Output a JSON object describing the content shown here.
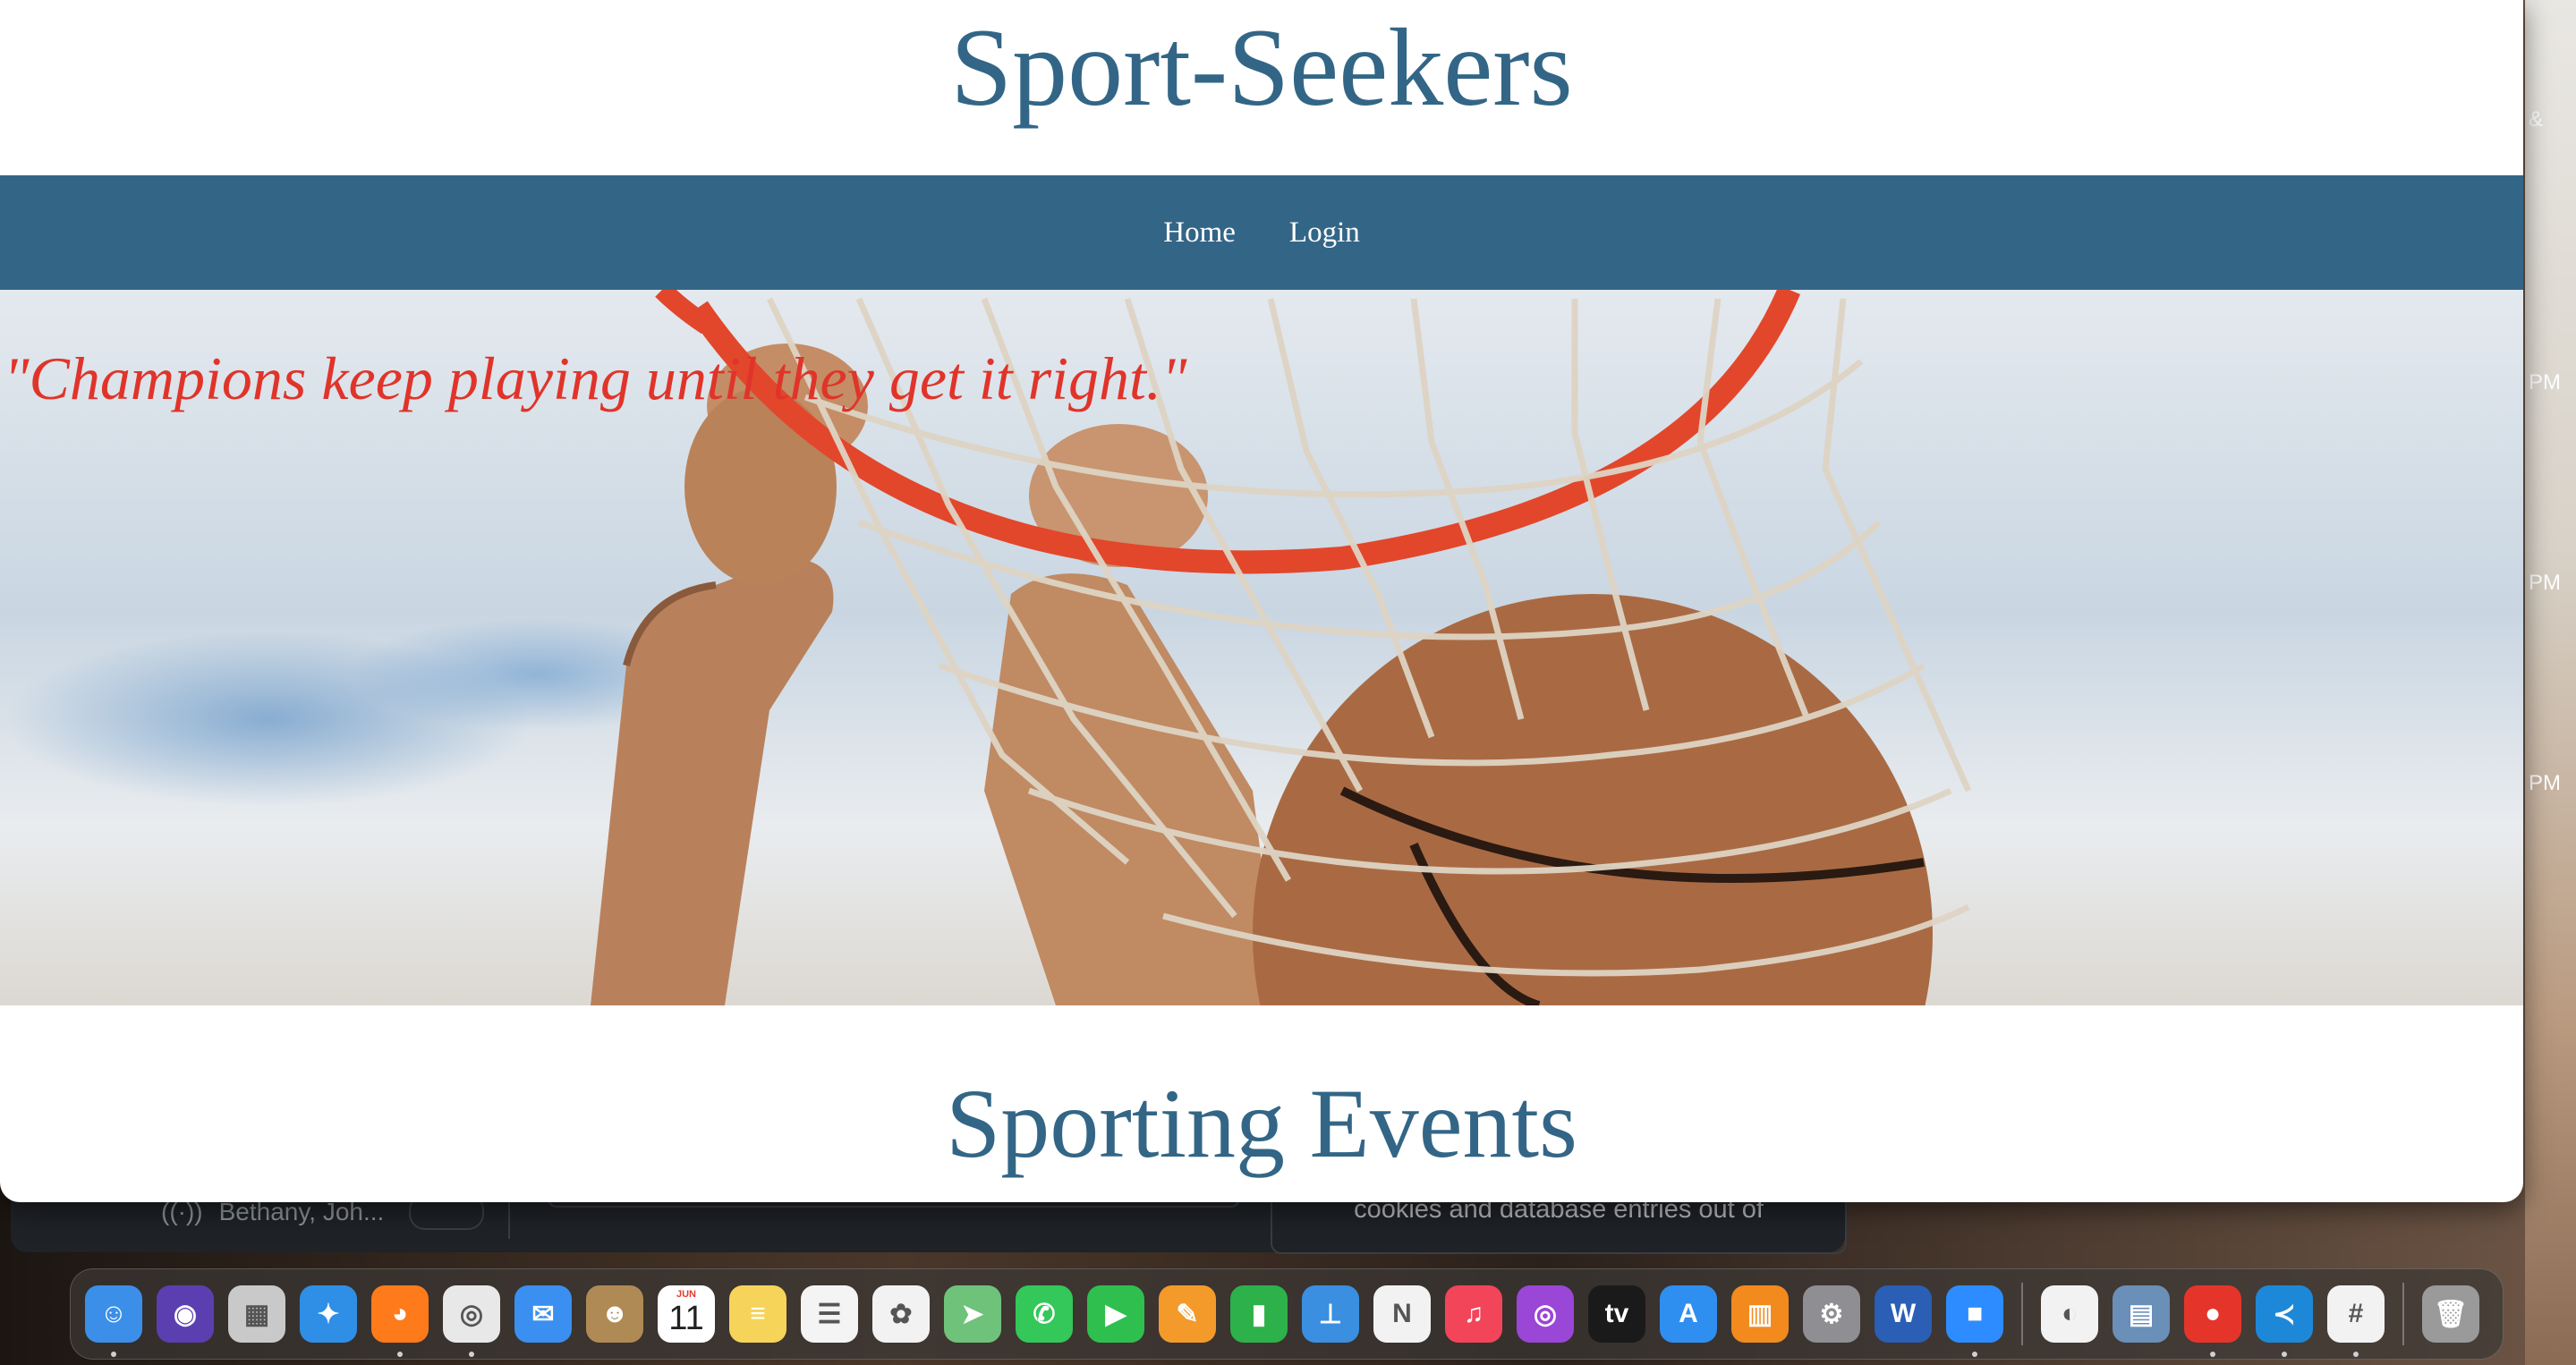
{
  "site": {
    "title": "Sport-Seekers",
    "nav": [
      {
        "label": "Home"
      },
      {
        "label": "Login"
      }
    ],
    "hero_quote": "\"Champions keep playing until they get it right.\"",
    "section_title": "Sporting Events"
  },
  "background": {
    "right_strip": [
      "& ",
      "PM",
      "PM",
      "PM"
    ],
    "back_window": {
      "participants": "Bethany, Joh...",
      "card_text": "cookies and database entries out of"
    }
  },
  "dock": {
    "calendar": {
      "month": "JUN",
      "day": "11"
    },
    "apps": [
      {
        "name": "finder-icon",
        "color": "#3b8fe8",
        "glyph": "☺",
        "running": true
      },
      {
        "name": "siri-icon",
        "color": "#5b3fb0",
        "glyph": "◉",
        "running": false
      },
      {
        "name": "launchpad-icon",
        "color": "#c9c9c9",
        "glyph": "▦",
        "running": false
      },
      {
        "name": "safari-icon",
        "color": "#2f8fe6",
        "glyph": "✦",
        "running": false
      },
      {
        "name": "firefox-icon",
        "color": "#ff7a1a",
        "glyph": "◕",
        "running": true
      },
      {
        "name": "chrome-icon",
        "color": "#e8e8e8",
        "glyph": "◎",
        "running": true
      },
      {
        "name": "mail-icon",
        "color": "#3a8ff0",
        "glyph": "✉",
        "running": false
      },
      {
        "name": "contacts-icon",
        "color": "#b08a55",
        "glyph": "☻",
        "running": false
      },
      {
        "name": "calendar-icon",
        "color": "#ffffff",
        "glyph": "",
        "running": false
      },
      {
        "name": "notes-icon",
        "color": "#f6d45a",
        "glyph": "≡",
        "running": false
      },
      {
        "name": "reminders-icon",
        "color": "#f4f4f4",
        "glyph": "☰",
        "running": false
      },
      {
        "name": "photos-icon",
        "color": "#f2f2f2",
        "glyph": "✿",
        "running": false
      },
      {
        "name": "maps-icon",
        "color": "#6fc27a",
        "glyph": "➤",
        "running": false
      },
      {
        "name": "messages-icon",
        "color": "#34c759",
        "glyph": "✆",
        "running": false
      },
      {
        "name": "facetime-icon",
        "color": "#2fbf4f",
        "glyph": "▶",
        "running": false
      },
      {
        "name": "pages-icon",
        "color": "#f39a2b",
        "glyph": "✎",
        "running": false
      },
      {
        "name": "numbers-icon",
        "color": "#2db14a",
        "glyph": "▮",
        "running": false
      },
      {
        "name": "keynote-icon",
        "color": "#3a8fe0",
        "glyph": "⊥",
        "running": false
      },
      {
        "name": "news-icon",
        "color": "#f2f2f2",
        "glyph": "N",
        "running": false
      },
      {
        "name": "music-icon",
        "color": "#f2455a",
        "glyph": "♫",
        "running": false
      },
      {
        "name": "podcasts-icon",
        "color": "#9a46d6",
        "glyph": "◎",
        "running": false
      },
      {
        "name": "apple-tv-icon",
        "color": "#1a1a1a",
        "glyph": "tv",
        "running": false
      },
      {
        "name": "app-store-icon",
        "color": "#2f8ff0",
        "glyph": "A",
        "running": false
      },
      {
        "name": "books-icon",
        "color": "#f28a1e",
        "glyph": "▥",
        "running": false
      },
      {
        "name": "system-settings-icon",
        "color": "#8e8e93",
        "glyph": "⚙",
        "running": false
      },
      {
        "name": "word-icon",
        "color": "#2b5eb5",
        "glyph": "W",
        "running": false
      },
      {
        "name": "zoom-icon",
        "color": "#2d8cff",
        "glyph": "■",
        "running": true
      }
    ],
    "apps_right": [
      {
        "name": "moon-app-icon",
        "color": "#f2f2f2",
        "glyph": "◐",
        "running": false
      },
      {
        "name": "preview-icon",
        "color": "#6a8fb8",
        "glyph": "▤",
        "running": false
      },
      {
        "name": "voice-memos-icon",
        "color": "#e5352b",
        "glyph": "●",
        "running": true
      },
      {
        "name": "vscode-icon",
        "color": "#1e88d8",
        "glyph": "≺",
        "running": true
      },
      {
        "name": "slack-icon",
        "color": "#f2f2f2",
        "glyph": "#",
        "running": true
      }
    ],
    "trash": {
      "name": "trash-icon",
      "color": "#9a9a9a",
      "glyph": "🗑",
      "running": false
    }
  }
}
